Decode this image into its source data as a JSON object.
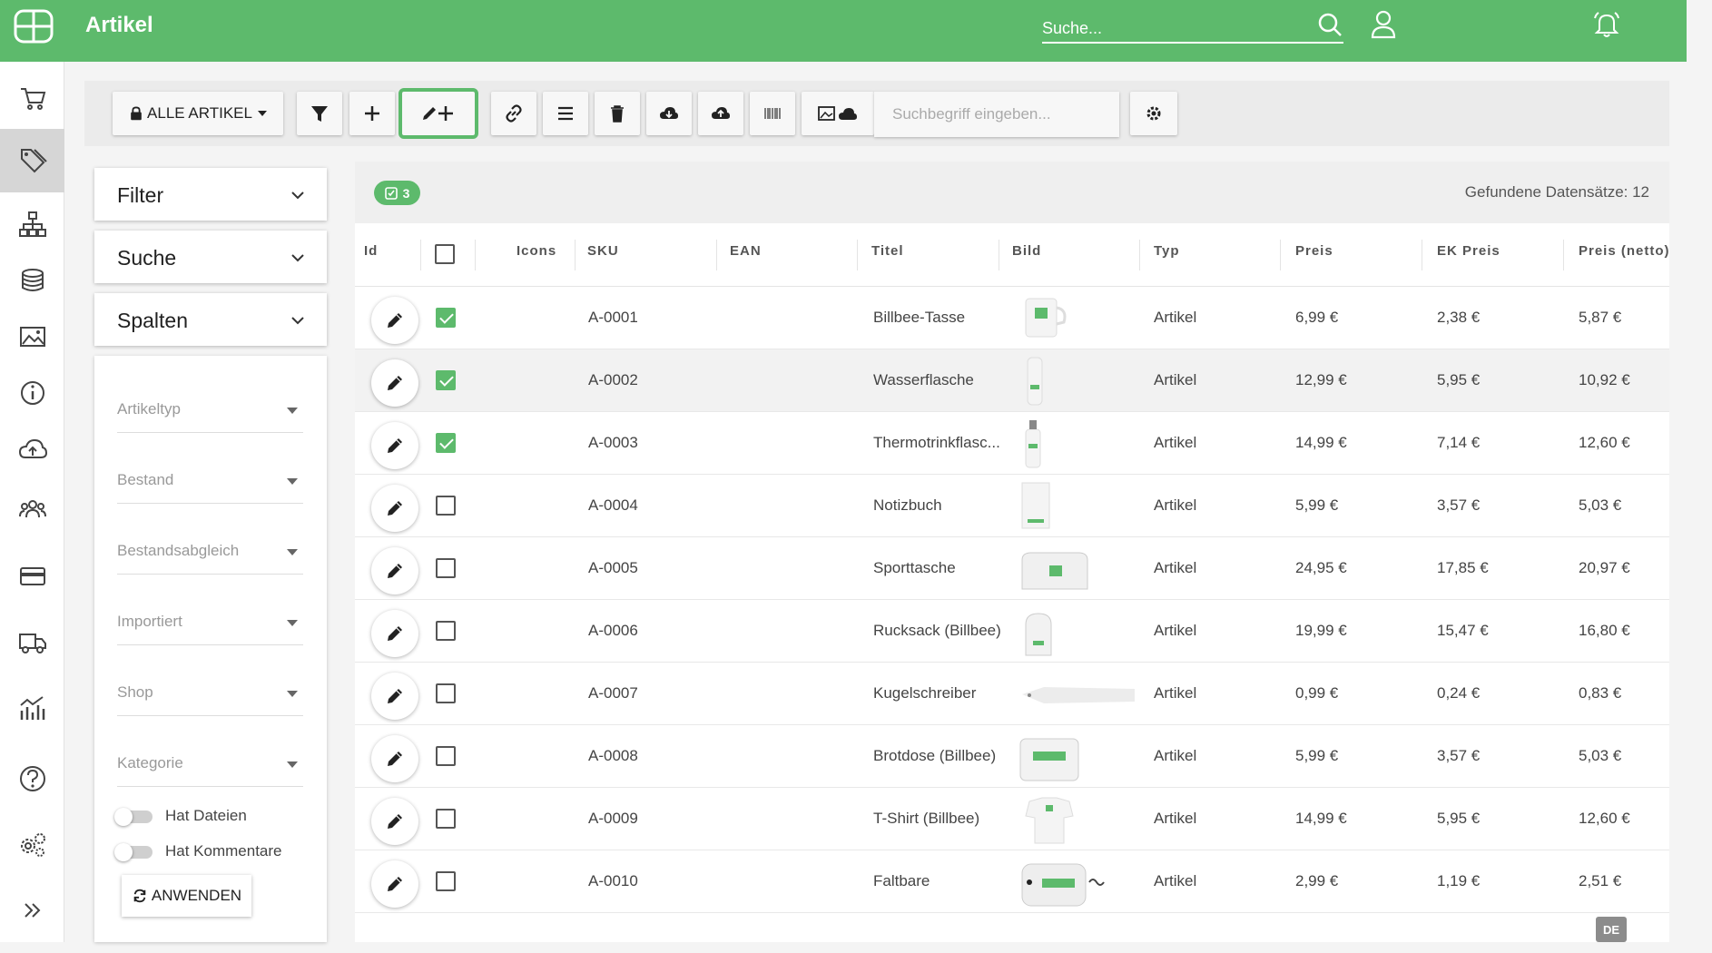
{
  "header": {
    "title": "Artikel",
    "search_placeholder": "Suche...",
    "accent_color": "#5dba6c"
  },
  "rail": {
    "items": [
      "cart-icon",
      "tag-icon",
      "hierarchy-icon",
      "stack-icon",
      "image-icon",
      "info-icon",
      "cloud-upload-icon",
      "users-icon",
      "card-icon",
      "truck-icon",
      "chart-icon",
      "help-icon",
      "settings-icon",
      "expand-icon"
    ],
    "active": "tag-icon"
  },
  "toolbar": {
    "all_label": "ALLE ARTIKEL",
    "search_placeholder": "Suchbegriff eingeben..."
  },
  "panels": {
    "filter": "Filter",
    "search": "Suche",
    "columns": "Spalten"
  },
  "filters": {
    "selects": [
      "Artikeltyp",
      "Bestand",
      "Bestandsabgleich",
      "Importiert",
      "Shop",
      "Kategorie"
    ],
    "toggle_files": "Hat Dateien",
    "toggle_comments": "Hat Kommentare",
    "apply_label": "ANWENDEN"
  },
  "grid": {
    "selected_count": "3",
    "found_label": "Gefundene Datensätze: 12",
    "columns": [
      "Id",
      "Icons",
      "SKU",
      "EAN",
      "Titel",
      "Bild",
      "Typ",
      "Preis",
      "EK Preis",
      "Preis (netto)"
    ],
    "rows": [
      {
        "sku": "A-0001",
        "title": "Billbee-Tasse",
        "type": "Artikel",
        "price": "6,99 €",
        "ek": "2,38 €",
        "net": "5,87 €",
        "checked": true
      },
      {
        "sku": "A-0002",
        "title": "Wasserflasche",
        "type": "Artikel",
        "price": "12,99 €",
        "ek": "5,95 €",
        "net": "10,92 €",
        "checked": true
      },
      {
        "sku": "A-0003",
        "title": "Thermotrinkflasc...",
        "type": "Artikel",
        "price": "14,99 €",
        "ek": "7,14 €",
        "net": "12,60 €",
        "checked": true
      },
      {
        "sku": "A-0004",
        "title": "Notizbuch",
        "type": "Artikel",
        "price": "5,99 €",
        "ek": "3,57 €",
        "net": "5,03 €",
        "checked": false
      },
      {
        "sku": "A-0005",
        "title": "Sporttasche",
        "type": "Artikel",
        "price": "24,95 €",
        "ek": "17,85 €",
        "net": "20,97 €",
        "checked": false
      },
      {
        "sku": "A-0006",
        "title": "Rucksack (Billbee)",
        "type": "Artikel",
        "price": "19,99 €",
        "ek": "15,47 €",
        "net": "16,80 €",
        "checked": false
      },
      {
        "sku": "A-0007",
        "title": "Kugelschreiber",
        "type": "Artikel",
        "price": "0,99 €",
        "ek": "0,24 €",
        "net": "0,83 €",
        "checked": false
      },
      {
        "sku": "A-0008",
        "title": "Brotdose (Billbee)",
        "type": "Artikel",
        "price": "5,99 €",
        "ek": "3,57 €",
        "net": "5,03 €",
        "checked": false
      },
      {
        "sku": "A-0009",
        "title": "T-Shirt (Billbee)",
        "type": "Artikel",
        "price": "14,99 €",
        "ek": "5,95 €",
        "net": "12,60 €",
        "checked": false
      },
      {
        "sku": "A-0010",
        "title": "Faltbare",
        "type": "Artikel",
        "price": "2,99 €",
        "ek": "1,19 €",
        "net": "2,51 €",
        "checked": false
      }
    ]
  },
  "language_badge": "DE"
}
